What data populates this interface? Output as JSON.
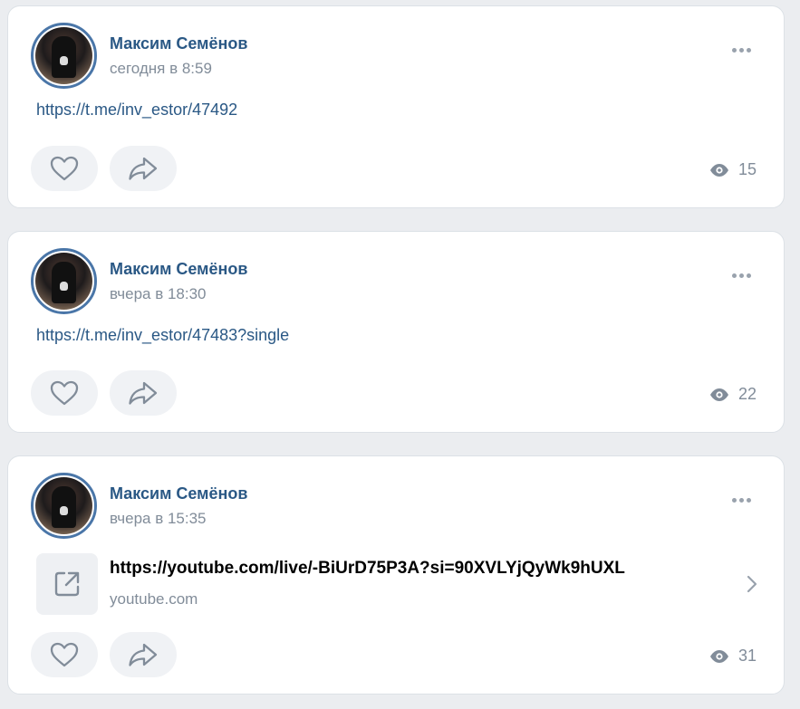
{
  "posts": [
    {
      "author": "Максим Семёнов",
      "time": "сегодня в 8:59",
      "text": "https://t.me/inv_estor/47492",
      "views": "15"
    },
    {
      "author": "Максим Семёнов",
      "time": "вчера в 18:30",
      "text": "https://t.me/inv_estor/47483?single",
      "views": "22"
    },
    {
      "author": "Максим Семёнов",
      "time": "вчера в 15:35",
      "snippet": {
        "title": "https://youtube.com/live/-BiUrD75P3A?si=90XVLYjQyWk9hUXL",
        "domain": "youtube.com",
        "icon": "external-link-icon"
      },
      "views": "31"
    }
  ],
  "icons": {
    "like": "heart-icon",
    "share": "share-arrow-icon",
    "views": "eye-icon",
    "more": "more-dots-icon",
    "chevron": "chevron-right-icon"
  },
  "colors": {
    "background": "#ebedf0",
    "author": "#2a5885",
    "link": "#2a5885",
    "secondary": "#818c99",
    "button_bg": "#f0f2f5",
    "avatar_ring": "#4a76a8"
  }
}
